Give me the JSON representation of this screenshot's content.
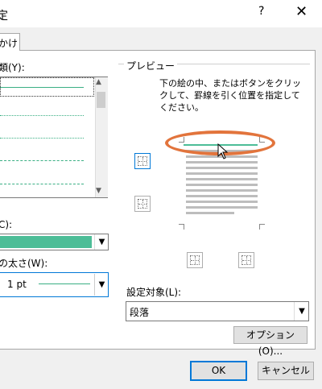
{
  "window": {
    "title": "定",
    "help": "?",
    "close": "✕"
  },
  "tab": {
    "label": "かけ"
  },
  "style": {
    "label": "類(Y):"
  },
  "color": {
    "label": "C):",
    "value": "#4dbd97"
  },
  "width": {
    "label": "の太さ(W):",
    "value": "1 pt"
  },
  "preview": {
    "label": "プレビュー",
    "description": "下の絵の中、またはボタンをクリックして、罫線を引く位置を指定してください。"
  },
  "apply_to": {
    "label": "設定対象(L):",
    "value": "段落"
  },
  "buttons": {
    "options": "オプション(O)...",
    "ok": "OK",
    "cancel": "キャンセル"
  },
  "icons": [
    "help-icon",
    "close-icon",
    "chevron-up-icon",
    "chevron-down-icon",
    "cursor-icon"
  ]
}
